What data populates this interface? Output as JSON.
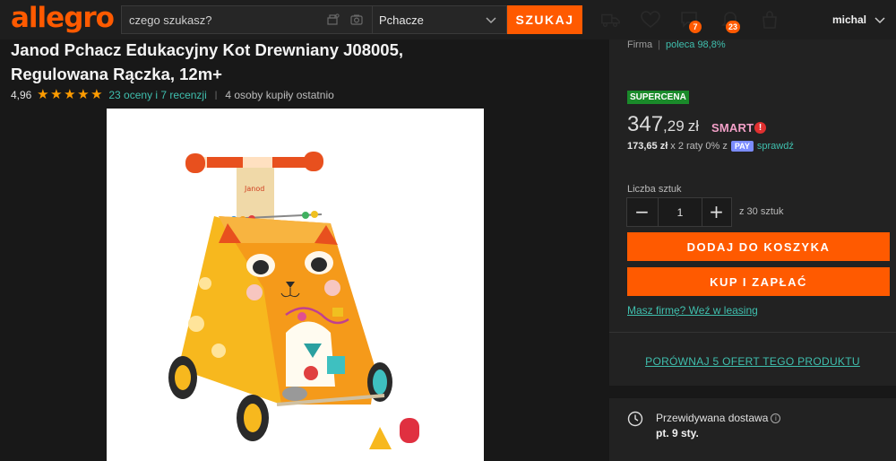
{
  "header": {
    "logo": "allegro",
    "search": {
      "placeholder": "czego szukasz?",
      "value": ""
    },
    "category": "Pchacze",
    "search_button": "SZUKAJ",
    "icons": [
      "camera-search-icon",
      "barcode-icon",
      "truck-icon",
      "heart-icon",
      "chat-icon",
      "bell-icon",
      "cart-icon"
    ],
    "chat_badge": "7",
    "bell_badge": "23",
    "username": "michal",
    "accent_color": "#ff5a00"
  },
  "product": {
    "title_line1": "Janod Pchacz Edukacyjny Kot Drewniany J08005,",
    "title_line2": "Regulowana Rączka, 12m+",
    "rating_value": "4,96",
    "rating_stars": 5,
    "rating_link": "23 oceny i 7 recenzji",
    "separator": "|",
    "buyers": "4 osoby kupiły ostatnio",
    "image_brand": "Janod"
  },
  "offer": {
    "seller_label": "Firma",
    "seller_pipe": "|",
    "seller_recommend": "poleca 98,8%",
    "badge": "SUPERCENA",
    "price_int": "347",
    "price_dec": ",29",
    "currency": "zł",
    "smart": "SMART",
    "smart_mark": "!",
    "installment_amount": "173,65 zł",
    "installment_text": "x 2 raty 0% z",
    "pay_badge": "PAY",
    "installment_link": "sprawdź",
    "qty_label": "Liczba sztuk",
    "qty_value": "1",
    "qty_minus": "−",
    "qty_plus": "+",
    "qty_available": "z 30 sztuk",
    "add_to_cart": "DODAJ DO KOSZYKA",
    "buy_now": "KUP I ZAPŁAĆ",
    "leasing_link": "Masz firmę? Weź w leasing",
    "compare_link": "PORÓWNAJ 5 OFERT TEGO PRODUKTU",
    "delivery_label": "Przewidywana dostawa",
    "delivery_info": "i",
    "delivery_date": "pt. 9 sty."
  }
}
